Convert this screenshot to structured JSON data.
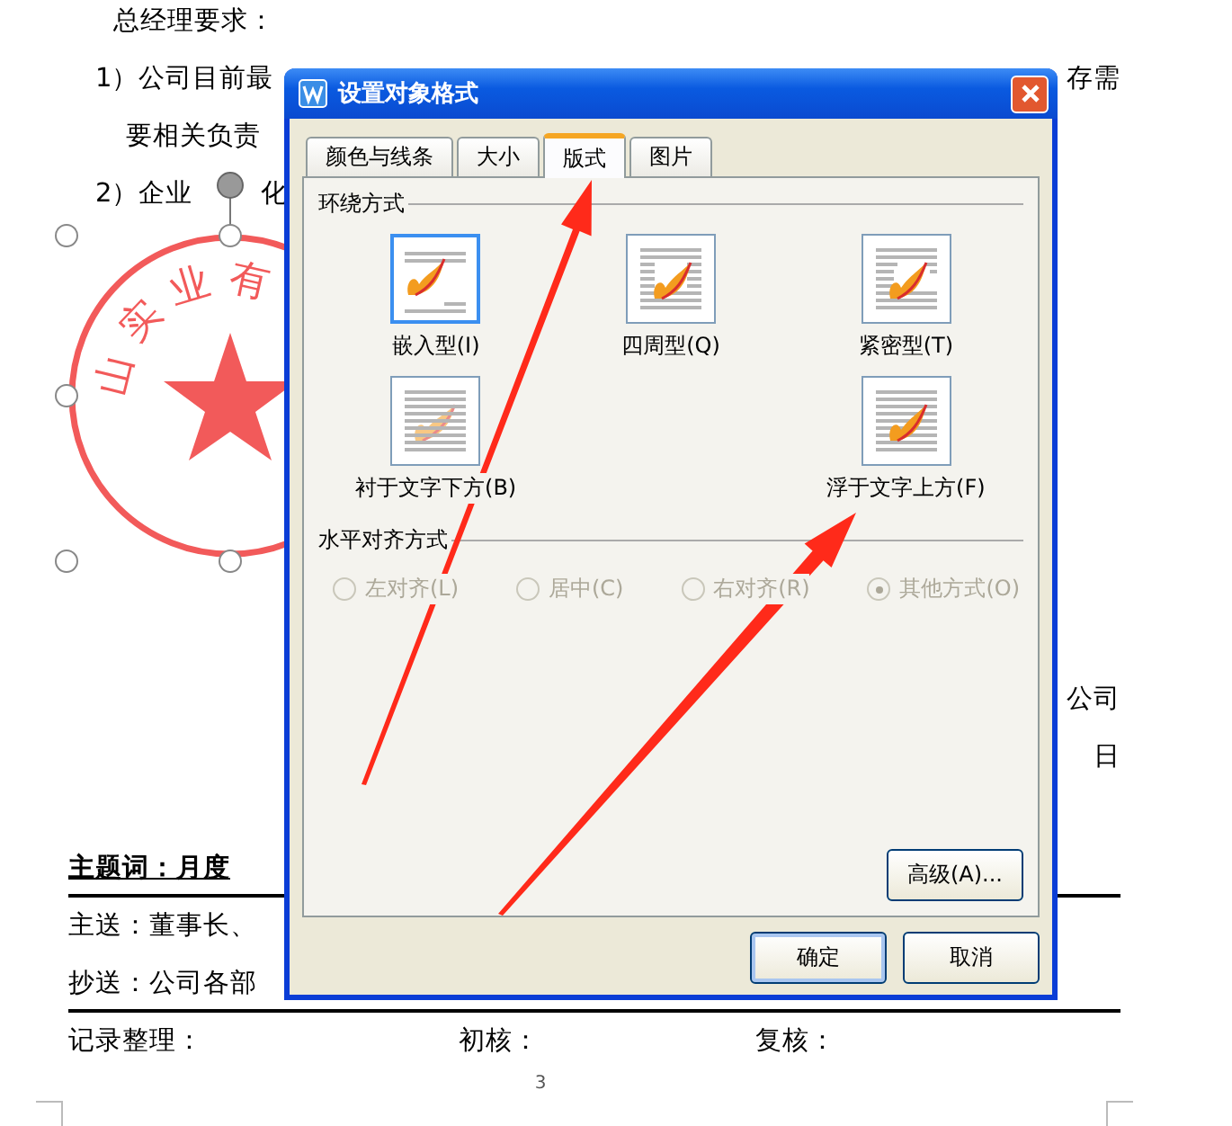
{
  "document": {
    "heading": "总经理要求：",
    "item_1": {
      "left": "1）公司目前最",
      "right": "存需"
    },
    "item_1_cont": "要相关负责",
    "item_2": {
      "left": "2）企业",
      "right": "化"
    },
    "seal": {
      "text": "山实业有"
    },
    "signature": {
      "company": "公司",
      "date": "日"
    },
    "subject": "主题词：月度",
    "to": "主送：董事长、",
    "cc": "抄送：公司各部",
    "footer": [
      "记录整理：",
      "初核：",
      "复核："
    ],
    "page_number": "3"
  },
  "dialog": {
    "title": "设置对象格式",
    "tabs": [
      {
        "label": "颜色与线条",
        "selected": false
      },
      {
        "label": "大小",
        "selected": false
      },
      {
        "label": "版式",
        "selected": true
      },
      {
        "label": "图片",
        "selected": false
      }
    ],
    "wrap_section": "环绕方式",
    "wrap_options": [
      {
        "label": "嵌入型(I)",
        "kind": "inline",
        "selected": true
      },
      {
        "label": "四周型(Q)",
        "kind": "square",
        "selected": false
      },
      {
        "label": "紧密型(T)",
        "kind": "tight",
        "selected": false
      },
      {
        "label": "衬于文字下方(B)",
        "kind": "behind",
        "selected": false
      },
      {
        "label": "浮于文字上方(F)",
        "kind": "front",
        "selected": false
      }
    ],
    "align_section": "水平对齐方式",
    "align_options": [
      {
        "label": "左对齐(L)",
        "selected": false,
        "disabled": true
      },
      {
        "label": "居中(C)",
        "selected": false,
        "disabled": true
      },
      {
        "label": "右对齐(R)",
        "selected": false,
        "disabled": true
      },
      {
        "label": "其他方式(O)",
        "selected": true,
        "disabled": true
      }
    ],
    "advanced_button": "高级(A)...",
    "buttons": [
      "确定",
      "取消"
    ]
  }
}
